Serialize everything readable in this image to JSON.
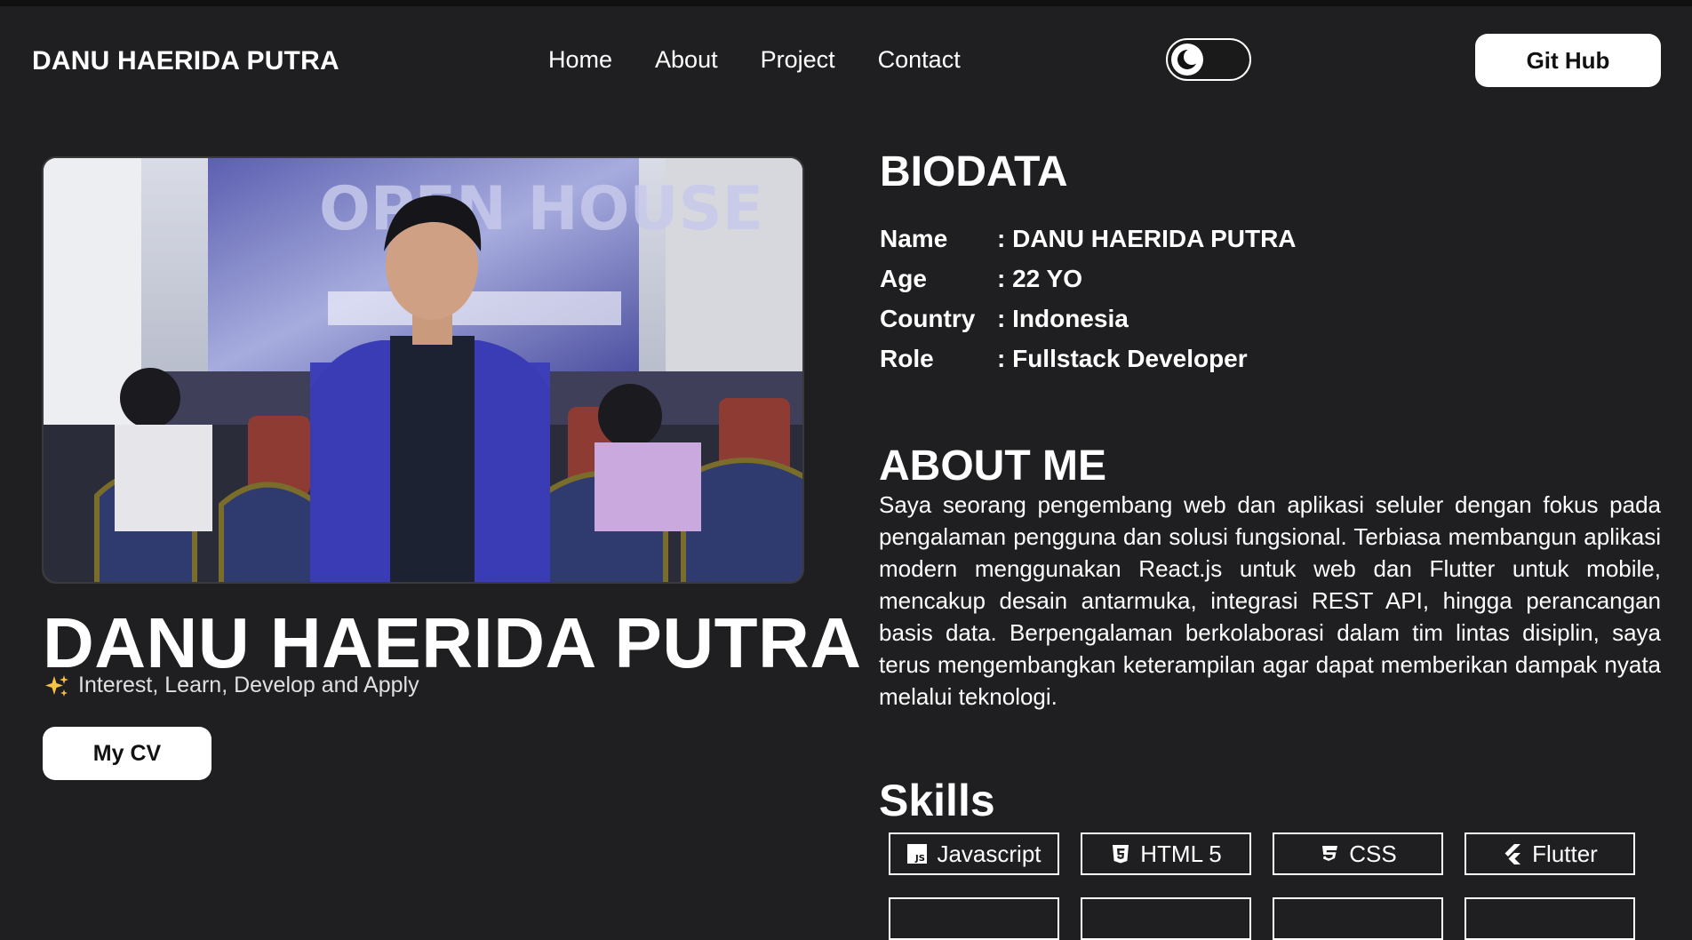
{
  "header": {
    "brand": "DANU HAERIDA PUTRA",
    "nav": [
      "Home",
      "About",
      "Project",
      "Contact"
    ],
    "theme_toggle_icon": "moon-icon",
    "github_label": "Git Hub"
  },
  "hero": {
    "name": "DANU HAERIDA PUTRA",
    "tagline": "Interest, Learn, Develop and Apply",
    "tagline_icon": "sparkles-icon",
    "cv_label": "My CV"
  },
  "biodata": {
    "title": "BIODATA",
    "rows": [
      {
        "key": "Name",
        "value": ": DANU HAERIDA PUTRA"
      },
      {
        "key": "Age",
        "value": ": 22 YO"
      },
      {
        "key": "Country",
        "value": ": Indonesia"
      },
      {
        "key": "Role",
        "value": ": Fullstack Developer"
      }
    ]
  },
  "about": {
    "title": "ABOUT ME",
    "text": "Saya seorang pengembang web dan aplikasi seluler dengan fokus pada pengalaman pengguna dan solusi fungsional. Terbiasa membangun aplikasi modern menggunakan React.js untuk web dan Flutter untuk mobile, mencakup desain antarmuka, integrasi REST API, hingga perancangan basis data. Berpengalaman berkolaborasi dalam tim lintas disiplin, saya terus mengembangkan keterampilan agar dapat memberikan dampak nyata melalui teknologi."
  },
  "skills": {
    "title": "Skills",
    "items": [
      {
        "label": "Javascript",
        "icon": "javascript-icon"
      },
      {
        "label": "HTML 5",
        "icon": "html5-icon"
      },
      {
        "label": "CSS",
        "icon": "css3-icon"
      },
      {
        "label": "Flutter",
        "icon": "flutter-icon"
      }
    ]
  },
  "colors": {
    "background": "#1f1f21",
    "text": "#ffffff",
    "button_bg": "#ffffff",
    "button_text": "#111111"
  }
}
